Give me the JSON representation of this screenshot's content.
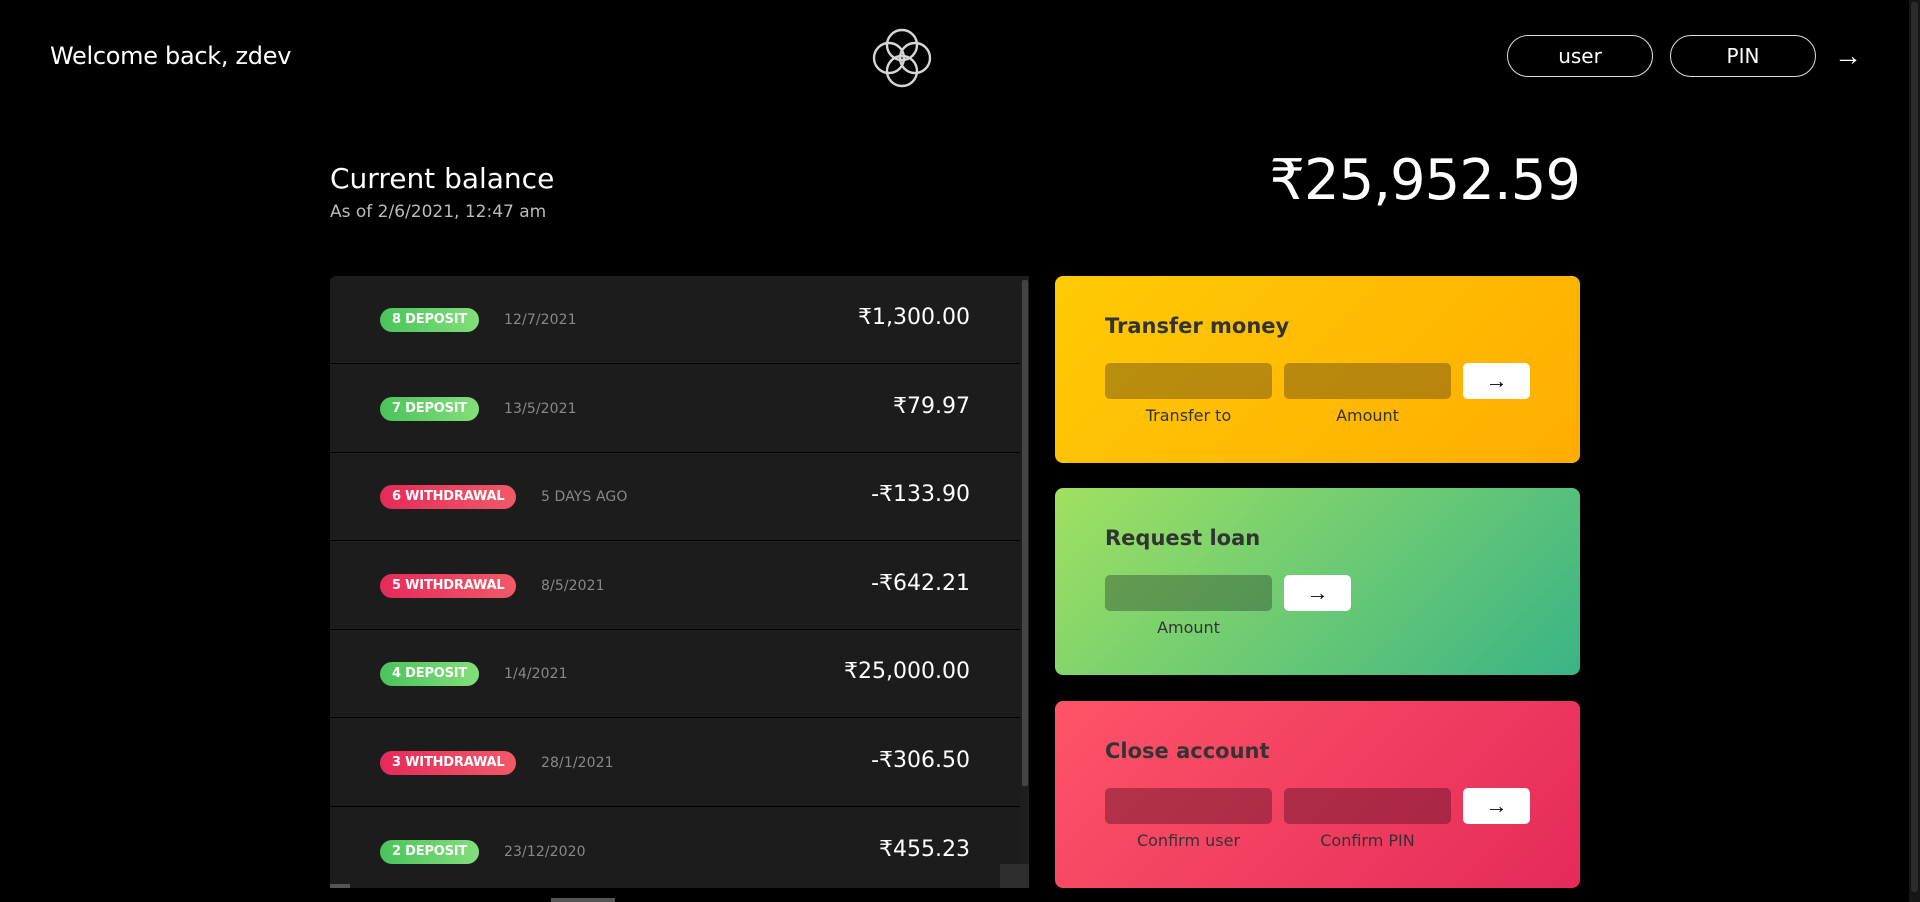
{
  "header": {
    "welcome": "Welcome back, zdev",
    "logo": "bankist-logo-icon",
    "login": {
      "user_placeholder": "user",
      "pin_placeholder": "PIN",
      "submit_icon": "→"
    }
  },
  "balance": {
    "title": "Current balance",
    "date": "As of 2/6/2021, 12:47 am",
    "value": "₹25,952.59"
  },
  "movements": [
    {
      "type_label": "8 DEPOSIT",
      "kind": "deposit",
      "date": "12/7/2021",
      "value": "₹1,300.00"
    },
    {
      "type_label": "7 DEPOSIT",
      "kind": "deposit",
      "date": "13/5/2021",
      "value": "₹79.97"
    },
    {
      "type_label": "6 WITHDRAWAL",
      "kind": "withdrawal",
      "date": "5 DAYS AGO",
      "value": "-₹133.90"
    },
    {
      "type_label": "5 WITHDRAWAL",
      "kind": "withdrawal",
      "date": "8/5/2021",
      "value": "-₹642.21"
    },
    {
      "type_label": "4 DEPOSIT",
      "kind": "deposit",
      "date": "1/4/2021",
      "value": "₹25,000.00"
    },
    {
      "type_label": "3 WITHDRAWAL",
      "kind": "withdrawal",
      "date": "28/1/2021",
      "value": "-₹306.50"
    },
    {
      "type_label": "2 DEPOSIT",
      "kind": "deposit",
      "date": "23/12/2020",
      "value": "₹455.23"
    }
  ],
  "operations": {
    "transfer": {
      "title": "Transfer money",
      "label1": "Transfer to",
      "label2": "Amount",
      "button": "→"
    },
    "loan": {
      "title": "Request loan",
      "label1": "Amount",
      "button": "→"
    },
    "close": {
      "title": "Close account",
      "label1": "Confirm user",
      "label2": "Confirm PIN",
      "button": "→"
    }
  },
  "colors": {
    "deposit": "#4ac35b",
    "withdrawal": "#e52a5a",
    "transfer": "#ffb003",
    "loan": "#39b385",
    "close": "#e52a5a"
  }
}
